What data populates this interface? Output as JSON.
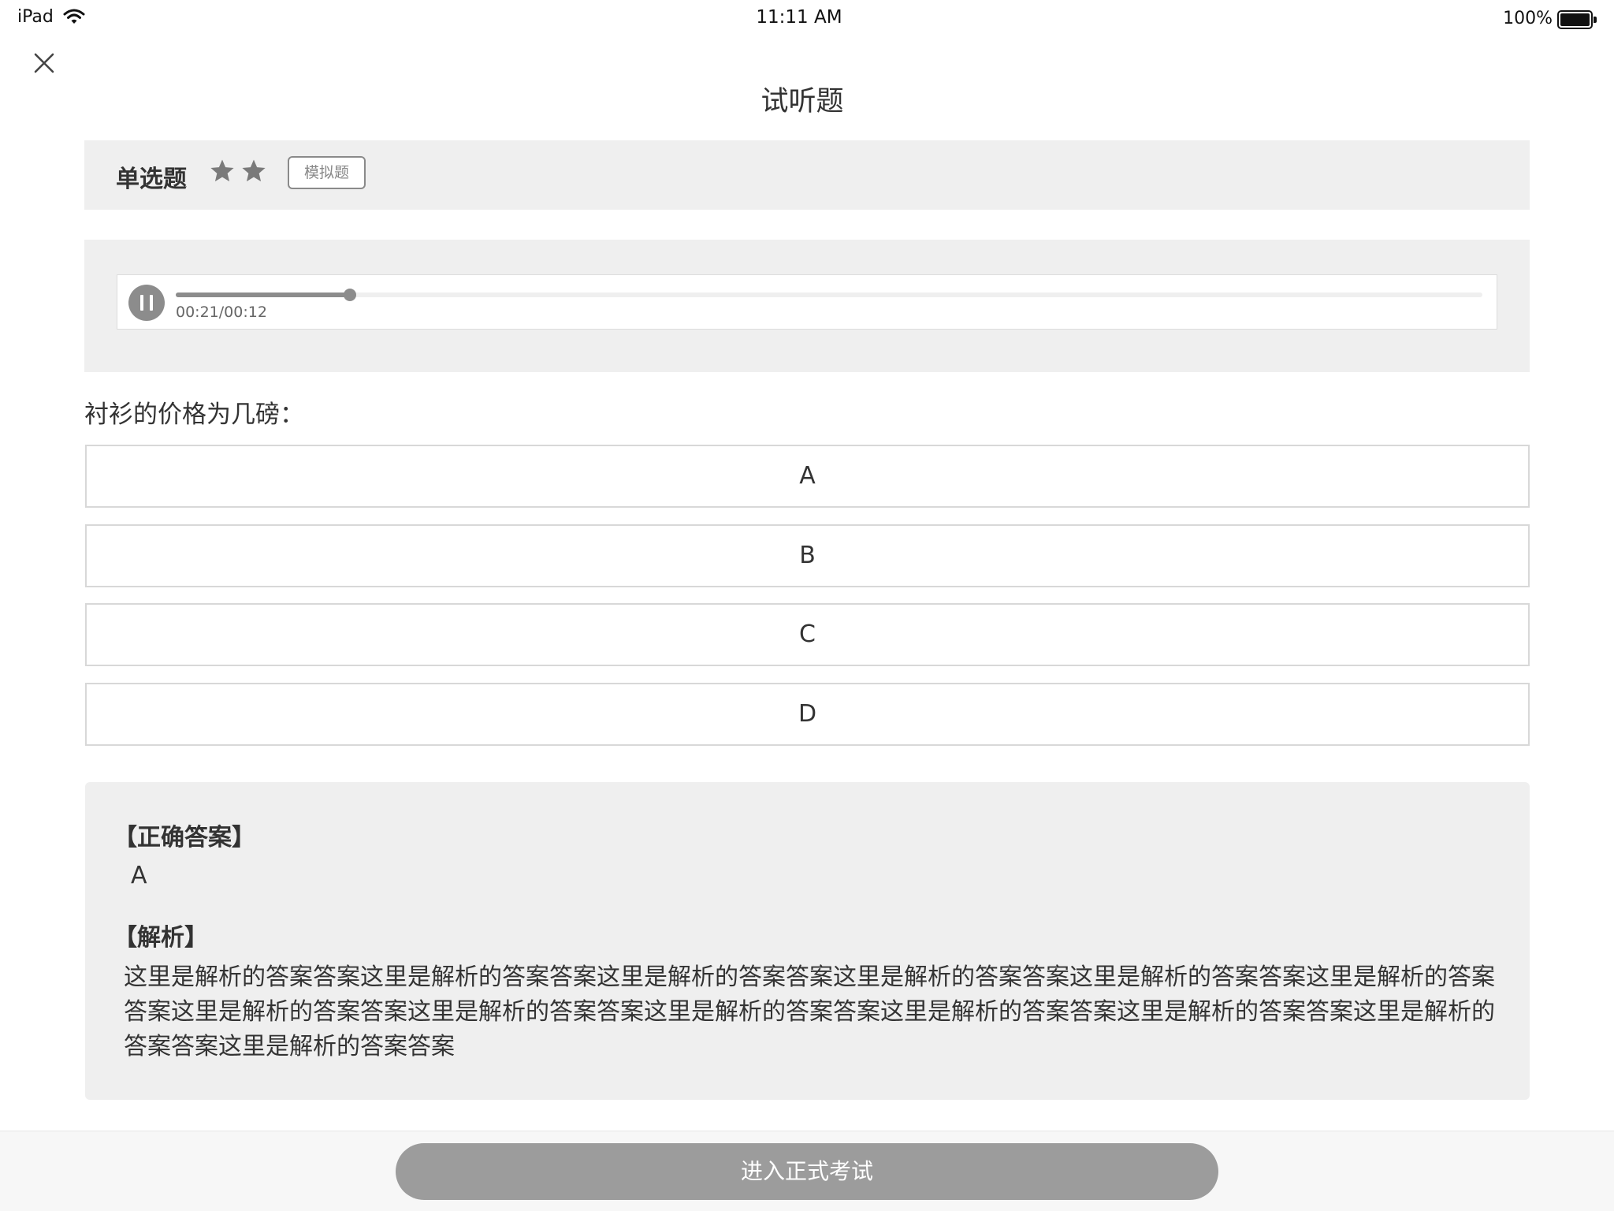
{
  "status_bar": {
    "device": "iPad",
    "time": "11:11 AM",
    "battery": "100%",
    "icons": [
      "wifi-icon",
      "battery-icon"
    ]
  },
  "nav": {
    "close_icon": "close-icon",
    "title": "试听题"
  },
  "question_header": {
    "type": "单选题",
    "difficulty_stars": 2,
    "tag": "模拟题"
  },
  "audio": {
    "time": "00:21/00:12",
    "progress": 0.133,
    "state": "playing"
  },
  "question": {
    "text": "衬衫的价格为几磅：",
    "options": [
      "A",
      "B",
      "C",
      "D"
    ]
  },
  "answer": {
    "correct_label": "【正确答案】",
    "correct_value": "A",
    "analysis_label": "【解析】",
    "analysis_text": "这里是解析的答案答案这里是解析的答案答案这里是解析的答案答案这里是解析的答案答案这里是解析的答案答案这里是解析的答案答案这里是解析的答案答案这里是解析的答案答案这里是解析的答案答案这里是解析的答案答案这里是解析的答案答案这里是解析的答案答案这里是解析的答案答案"
  },
  "footer": {
    "button_label": "进入正式考试"
  },
  "colors": {
    "panel_bg": "#efefef",
    "accent_gray": "#8c8c8c",
    "button_bg": "#9c9c9c",
    "text": "#333333"
  }
}
